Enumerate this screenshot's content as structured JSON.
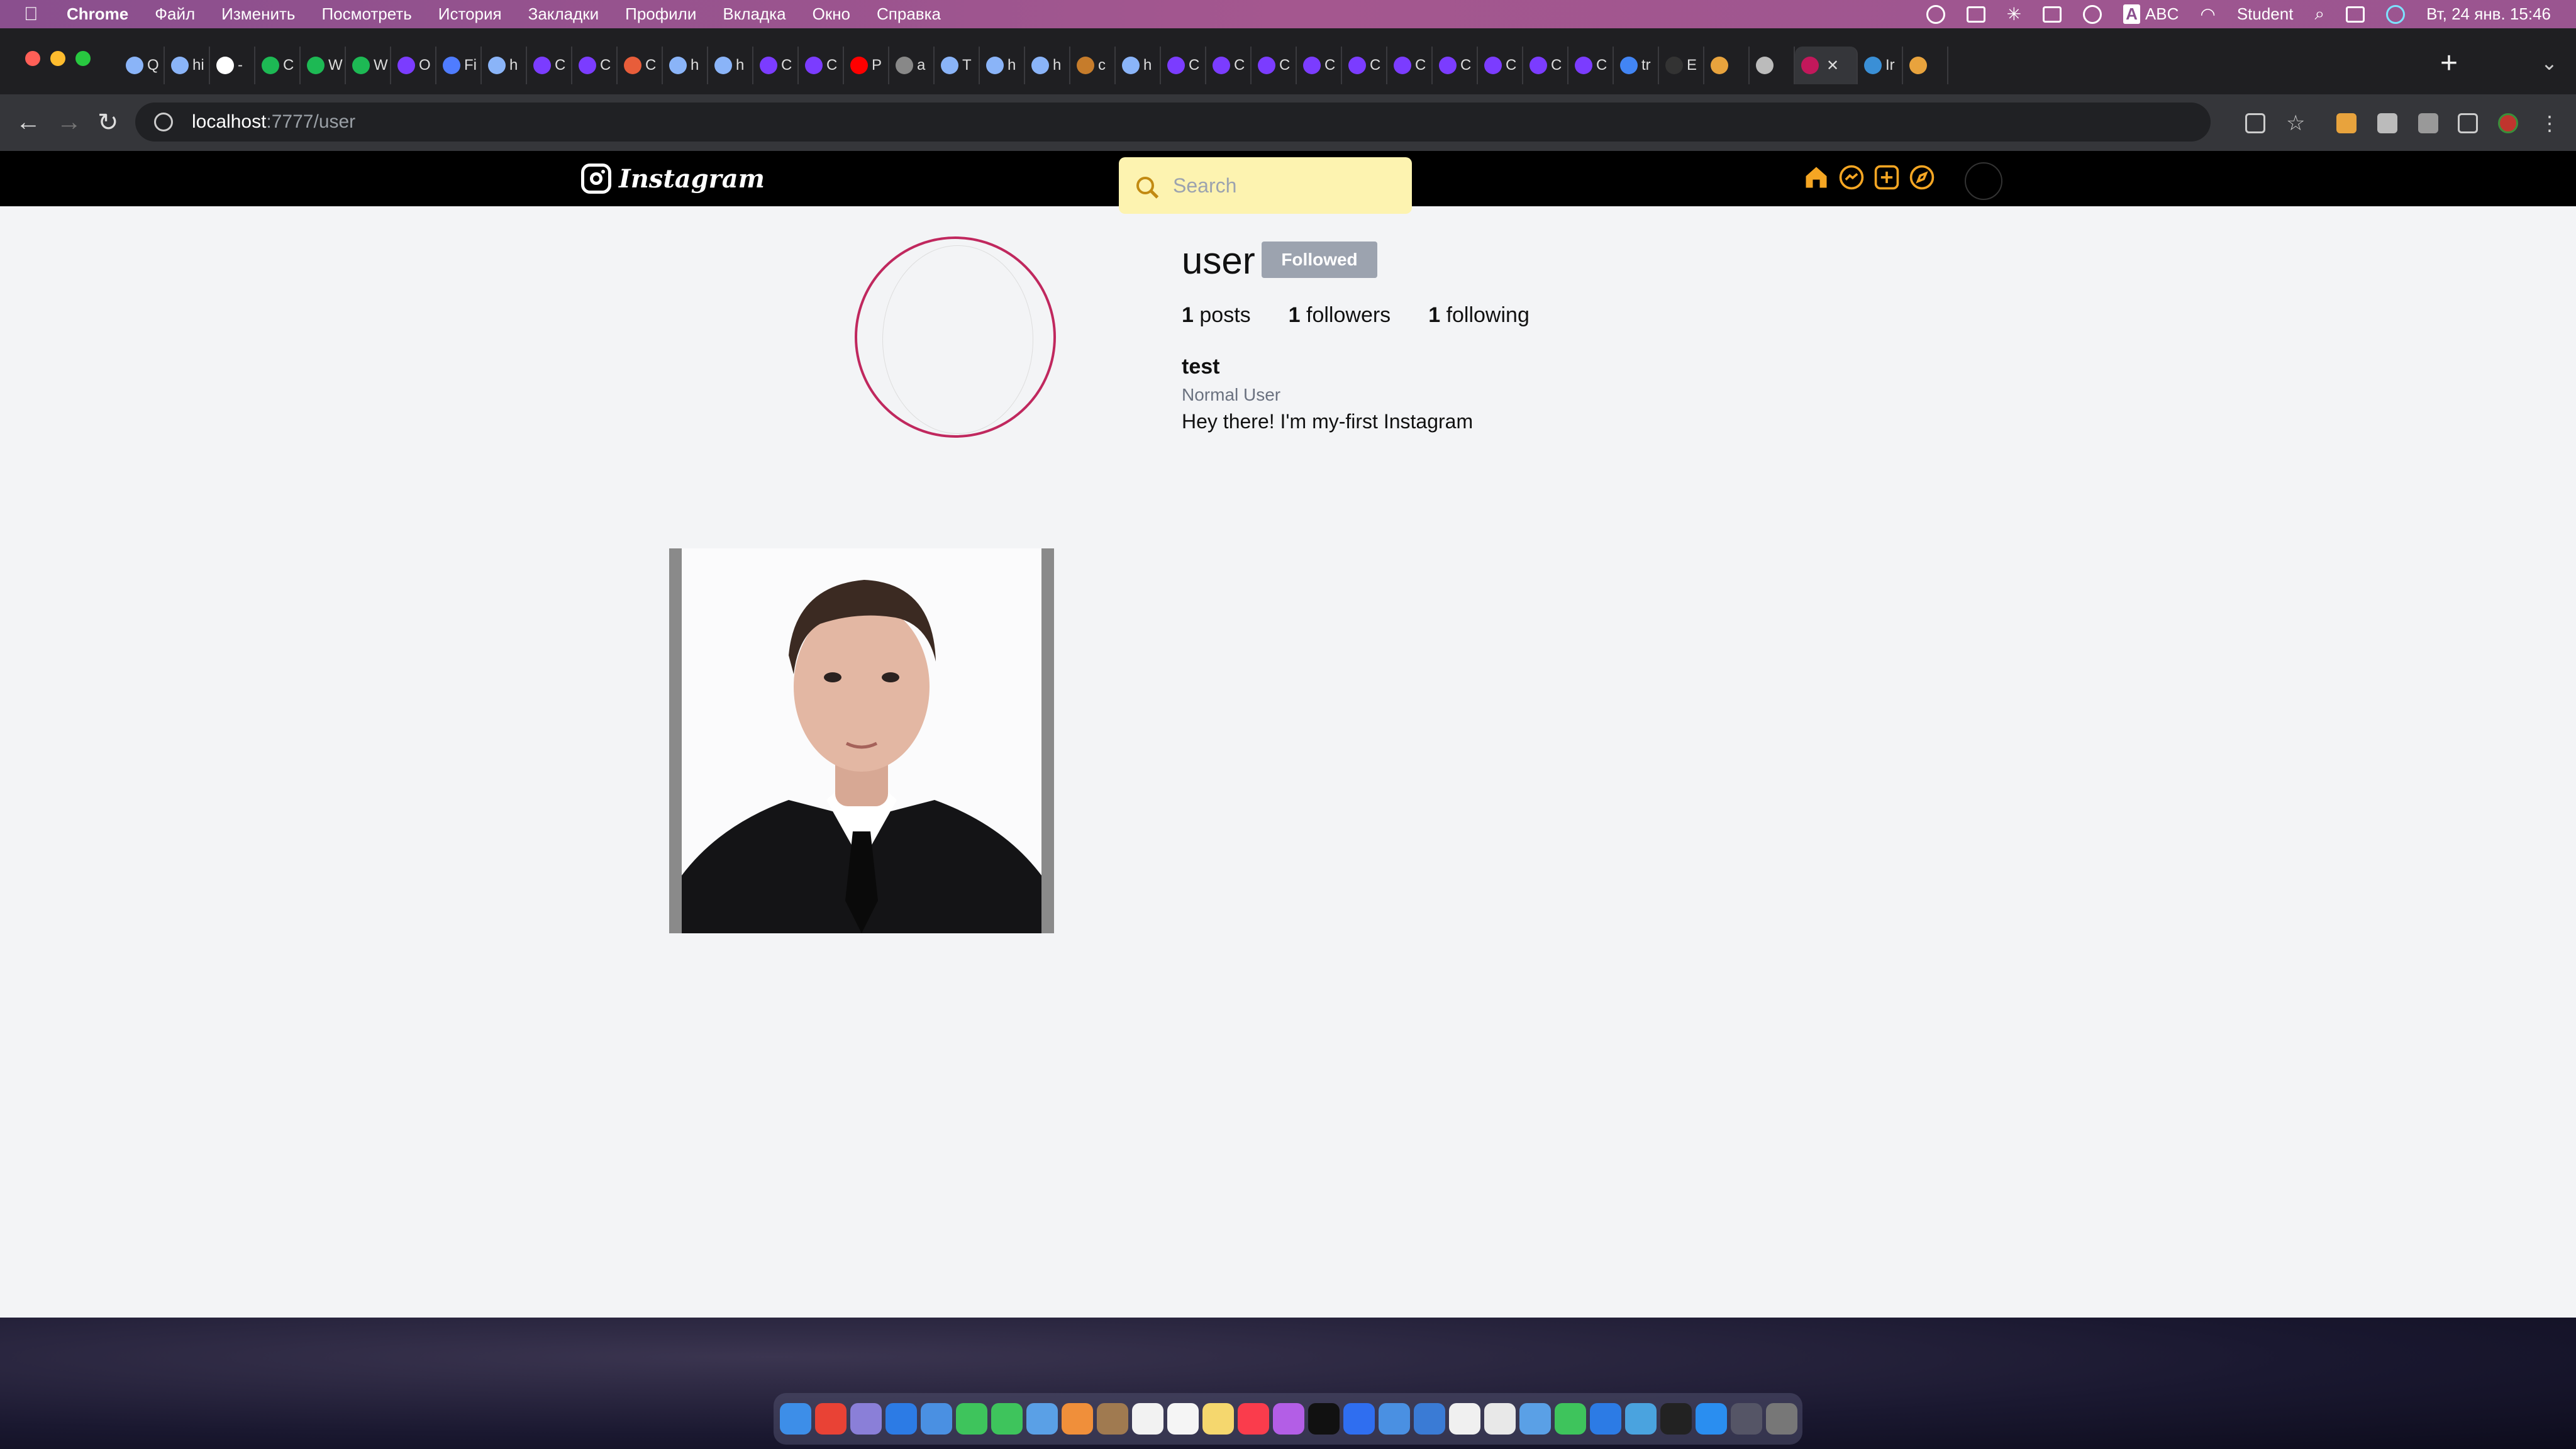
{
  "menubar": {
    "items": [
      "Chrome",
      "Файл",
      "Изменить",
      "Посмотреть",
      "История",
      "Закладки",
      "Профили",
      "Вкладка",
      "Окно",
      "Справка"
    ],
    "input_source": "ABC",
    "user": "Student",
    "datetime": "Вт, 24 янв.  15:46"
  },
  "browser": {
    "tab_letters": [
      "Q",
      "hi",
      "-",
      "C",
      "W",
      "W",
      "O",
      "Fi",
      "h",
      "C",
      "C",
      "C",
      "h",
      "h",
      "C",
      "C",
      "P",
      "a",
      "T",
      "h",
      "h",
      "c",
      "h",
      "C",
      "C",
      "C",
      "C",
      "C",
      "C",
      "C",
      "C",
      "C",
      "C",
      "tr",
      "E",
      "",
      "",
      "",
      "Ir",
      ""
    ],
    "url_host": "localhost",
    "url_path": ":7777/user"
  },
  "app": {
    "logo_text": "Instagram",
    "search_placeholder": "Search",
    "nav_icons": [
      "home-icon",
      "messenger-icon",
      "add-post-icon",
      "explore-icon"
    ],
    "accent_color": "#f5a623"
  },
  "profile": {
    "username": "user",
    "follow_button": "Followed",
    "stats": {
      "posts": "1",
      "posts_label": "posts",
      "followers": "1",
      "followers_label": "followers",
      "following": "1",
      "following_label": "following"
    },
    "full_name": "test",
    "role": "Normal User",
    "bio": "Hey there! I'm my-first Instagram"
  }
}
